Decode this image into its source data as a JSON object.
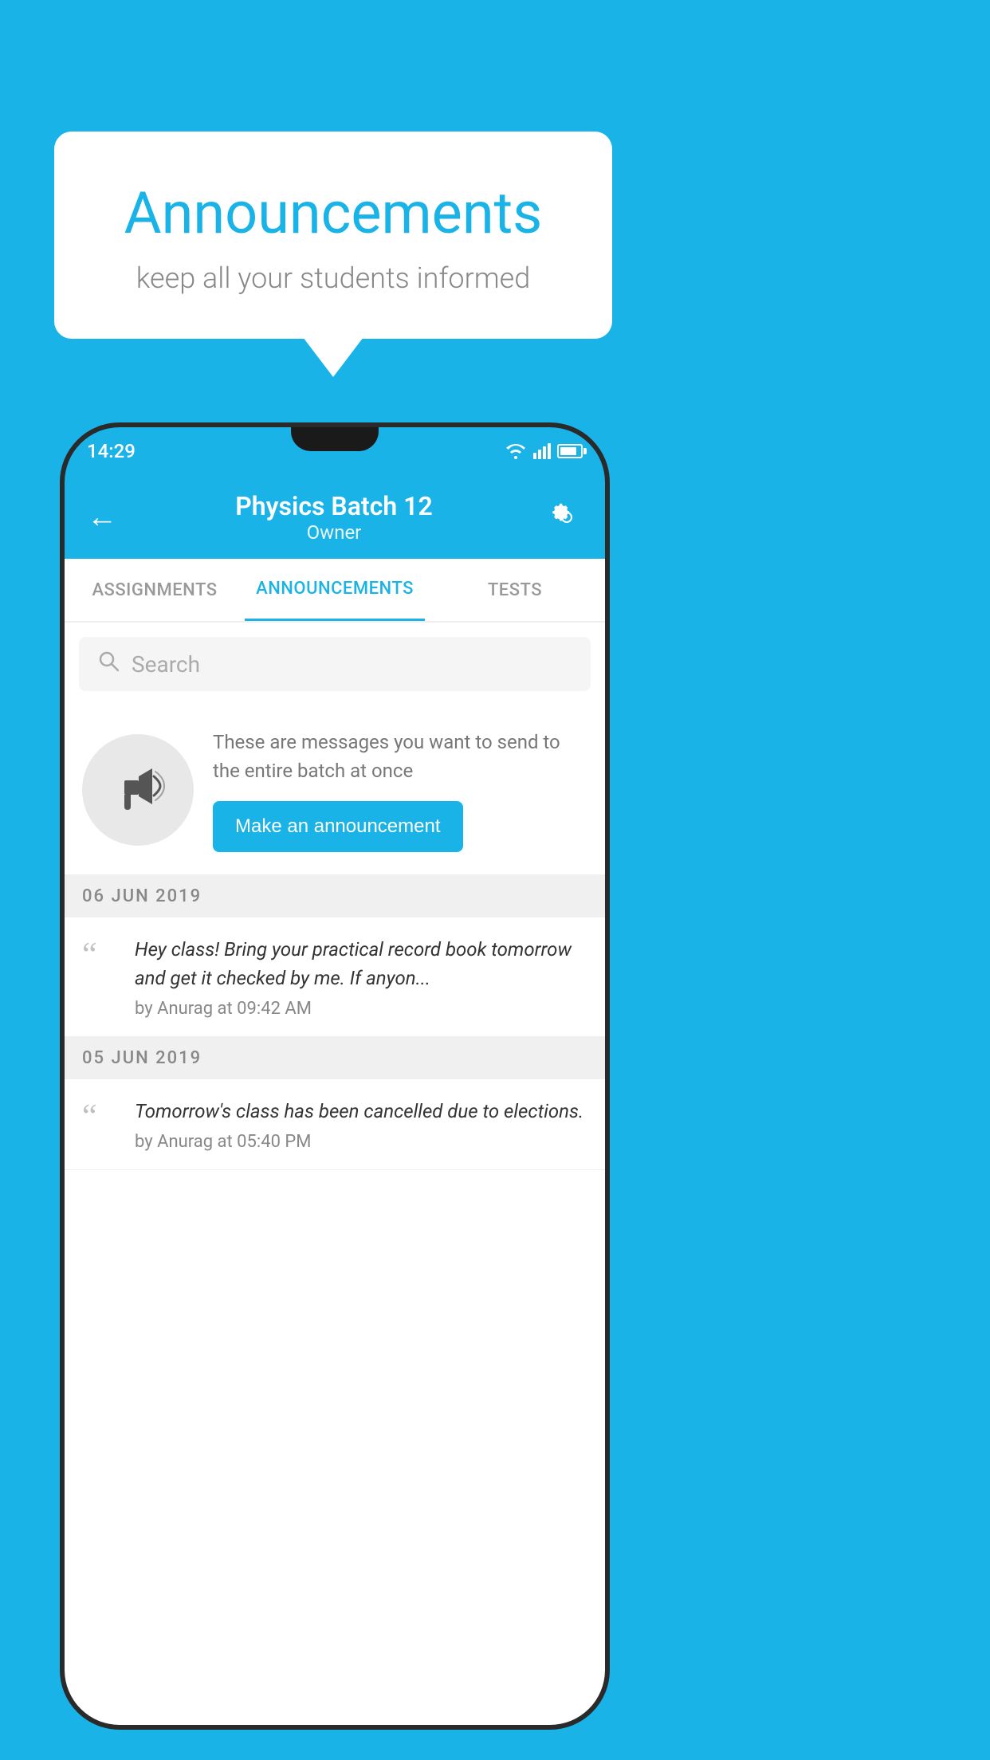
{
  "background": {
    "color": "#1ab3e8"
  },
  "speech_bubble": {
    "title": "Announcements",
    "subtitle": "keep all your students informed"
  },
  "phone": {
    "status_bar": {
      "time": "14:29"
    },
    "header": {
      "title": "Physics Batch 12",
      "subtitle": "Owner",
      "back_label": "←"
    },
    "tabs": [
      {
        "label": "ASSIGNMENTS",
        "active": false
      },
      {
        "label": "ANNOUNCEMENTS",
        "active": true
      },
      {
        "label": "TESTS",
        "active": false
      }
    ],
    "search": {
      "placeholder": "Search"
    },
    "promo": {
      "description": "These are messages you want to send to the entire batch at once",
      "button_label": "Make an announcement"
    },
    "announcements": [
      {
        "date": "06  JUN  2019",
        "text": "Hey class! Bring your practical record book tomorrow and get it checked by me. If anyon...",
        "by": "by Anurag at 09:42 AM"
      },
      {
        "date": "05  JUN  2019",
        "text": "Tomorrow's class has been cancelled due to elections.",
        "by": "by Anurag at 05:40 PM"
      }
    ]
  }
}
